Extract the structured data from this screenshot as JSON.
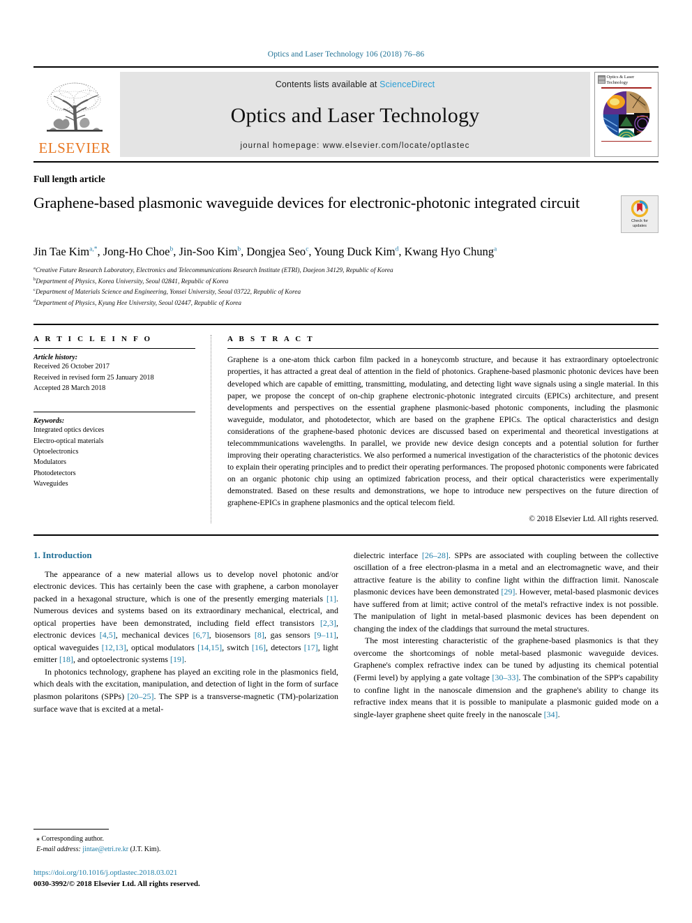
{
  "running_head": "Optics and Laser Technology 106 (2018) 76–86",
  "masthead": {
    "publisher_wordmark": "ELSEVIER",
    "contents_prefix": "Contents lists available at ",
    "contents_link": "ScienceDirect",
    "journal_name": "Optics and Laser Technology",
    "homepage": "journal homepage: www.elsevier.com/locate/optlastec",
    "cover_title_line1": "Optics & Laser",
    "cover_title_line2": "Technology"
  },
  "article": {
    "type": "Full length article",
    "title": "Graphene-based plasmonic waveguide devices for electronic-photonic integrated circuit",
    "crossmark_line1": "Check for",
    "crossmark_line2": "updates"
  },
  "authors": [
    {
      "name": "Jin Tae Kim",
      "marks": "a,*"
    },
    {
      "name": "Jong-Ho Choe",
      "marks": "b"
    },
    {
      "name": "Jin-Soo Kim",
      "marks": "b"
    },
    {
      "name": "Dongjea Seo",
      "marks": "c"
    },
    {
      "name": "Young Duck Kim",
      "marks": "d"
    },
    {
      "name": "Kwang Hyo Chung",
      "marks": "a"
    }
  ],
  "affiliations": [
    {
      "mark": "a",
      "text": "Creative Future Research Laboratory, Electronics and Telecommunications Research Institute (ETRI), Daejeon 34129, Republic of Korea"
    },
    {
      "mark": "b",
      "text": "Department of Physics, Korea University, Seoul 02841, Republic of Korea"
    },
    {
      "mark": "c",
      "text": "Department of Materials Science and Engineering, Yonsei University, Seoul 03722, Republic of Korea"
    },
    {
      "mark": "d",
      "text": "Department of Physics, Kyung Hee University, Seoul 02447, Republic of Korea"
    }
  ],
  "article_info": {
    "heading": "A R T I C L E   I N F O",
    "history_label": "Article history:",
    "history": [
      "Received 26 October 2017",
      "Received in revised form 25 January 2018",
      "Accepted 28 March 2018"
    ],
    "keywords_label": "Keywords:",
    "keywords": [
      "Integrated optics devices",
      "Electro-optical materials",
      "Optoelectronics",
      "Modulators",
      "Photodetectors",
      "Waveguides"
    ]
  },
  "abstract": {
    "heading": "A B S T R A C T",
    "text": "Graphene is a one-atom thick carbon film packed in a honeycomb structure, and because it has extraordinary optoelectronic properties, it has attracted a great deal of attention in the field of photonics. Graphene-based plasmonic photonic devices have been developed which are capable of emitting, transmitting, modulating, and detecting light wave signals using a single material. In this paper, we propose the concept of on-chip graphene electronic-photonic integrated circuits (EPICs) architecture, and present developments and perspectives on the essential graphene plasmonic-based photonic components, including the plasmonic waveguide, modulator, and photodetector, which are based on the graphene EPICs. The optical characteristics and design considerations of the graphene-based photonic devices are discussed based on experimental and theoretical investigations at telecommmunications wavelengths. In parallel, we provide new device design concepts and a potential solution for further improving their operating characteristics. We also performed a numerical investigation of the characteristics of the photonic devices to explain their operating principles and to predict their operating performances. The proposed photonic components were fabricated on an organic photonic chip using an optimized fabrication process, and their optical characteristics were experimentally demonstrated. Based on these results and demonstrations, we hope to introduce new perspectives on the future direction of graphene-EPICs in graphene plasmonics and the optical telecom field.",
    "copyright": "© 2018 Elsevier Ltd. All rights reserved."
  },
  "introduction": {
    "section_title": "1. Introduction",
    "left_paragraphs": [
      "The appearance of a new material allows us to develop novel photonic and/or electronic devices. This has certainly been the case with graphene, a carbon monolayer packed in a hexagonal structure, which is one of the presently emerging materials [1]. Numerous devices and systems based on its extraordinary mechanical, electrical, and optical properties have been demonstrated, including field effect transistors [2,3], electronic devices [4,5], mechanical devices [6,7], biosensors [8], gas sensors [9–11], optical waveguides [12,13], optical modulators [14,15], switch [16], detectors [17], light emitter [18], and optoelectronic systems [19].",
      "In photonics technology, graphene has played an exciting role in the plasmonics field, which deals with the excitation, manipulation, and detection of light in the form of surface plasmon polaritons (SPPs) [20–25]. The SPP is a transverse-magnetic (TM)-polarization surface wave that is excited at a metal-"
    ],
    "right_paragraphs": [
      "dielectric interface [26–28]. SPPs are associated with coupling between the collective oscillation of a free electron-plasma in a metal and an electromagnetic wave, and their attractive feature is the ability to confine light within the diffraction limit. Nanoscale plasmonic devices have been demonstrated [29]. However, metal-based plasmonic devices have suffered from at limit; active control of the metal's refractive index is not possible. The manipulation of light in metal-based plasmonic devices has been dependent on changing the index of the claddings that surround the metal structures.",
      "The most interesting characteristic of the graphene-based plasmonics is that they overcome the shortcomings of noble metal-based plasmonic waveguide devices. Graphene's complex refractive index can be tuned by adjusting its chemical potential (Fermi level) by applying a gate voltage [30–33]. The combination of the SPP's capability to confine light in the nanoscale dimension and the graphene's ability to change its refractive index means that it is possible to manipulate a plasmonic guided mode on a single-layer graphene sheet quite freely in the nanoscale [34]."
    ]
  },
  "footnotes": {
    "corresponding_marker": "⁎",
    "corresponding_text": "Corresponding author.",
    "email_label": "E-mail address:",
    "email": "jintae@etri.re.kr",
    "email_owner": "(J.T. Kim)."
  },
  "bottom": {
    "doi": "https://doi.org/10.1016/j.optlastec.2018.03.021",
    "issn_copyright": "0030-3992/© 2018 Elsevier Ltd. All rights reserved."
  },
  "colors": {
    "link": "#1f7ea8",
    "running_head": "#1f7094",
    "sciencedirect": "#2a9fd6",
    "elsevier_orange": "#E87722",
    "section_heading": "#1f6e96",
    "cover_rule": "#a3231f"
  }
}
